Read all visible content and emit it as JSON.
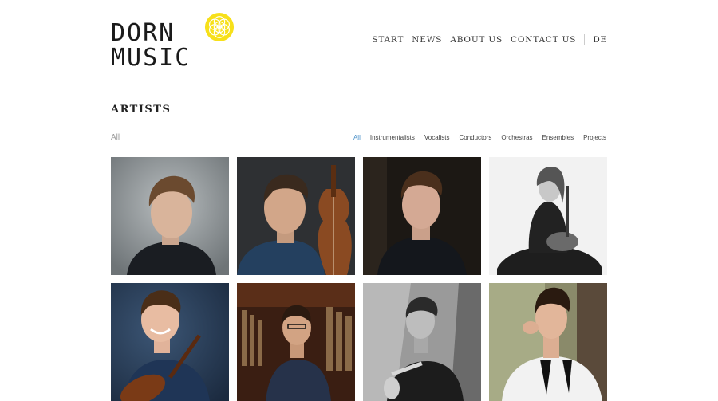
{
  "logo": {
    "line1": "DORN",
    "line2": "MUSIC",
    "mark_color": "#f7e01a"
  },
  "nav": {
    "items": [
      {
        "label": "START",
        "active": true
      },
      {
        "label": "NEWS",
        "active": false
      },
      {
        "label": "ABOUT US",
        "active": false
      },
      {
        "label": "CONTACT US",
        "active": false
      }
    ],
    "language": "DE",
    "accent_color": "#4a90c8"
  },
  "artists": {
    "title": "ARTISTS",
    "current_filter": "All",
    "filters": [
      {
        "label": "All",
        "active": true
      },
      {
        "label": "Instrumentalists",
        "active": false
      },
      {
        "label": "Vocalists",
        "active": false
      },
      {
        "label": "Conductors",
        "active": false
      },
      {
        "label": "Orchestras",
        "active": false
      },
      {
        "label": "Ensembles",
        "active": false
      },
      {
        "label": "Projects",
        "active": false
      }
    ]
  }
}
